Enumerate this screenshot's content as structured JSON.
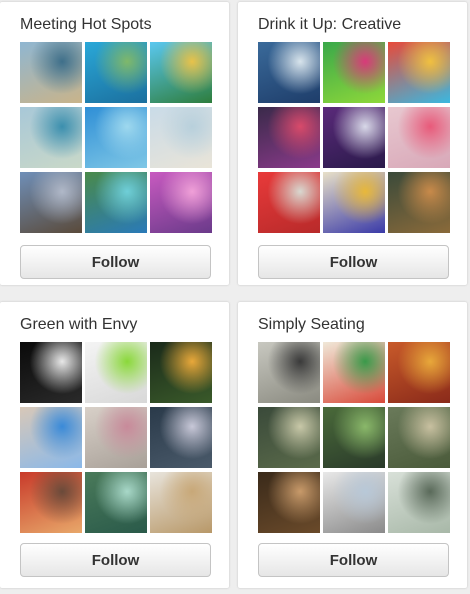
{
  "boards": [
    {
      "title": "Meeting Hot Spots",
      "follow_label": "Follow",
      "thumbnails": [
        {
          "colors": [
            "#8fb6d1",
            "#3e6f8a",
            "#c9b48a"
          ]
        },
        {
          "colors": [
            "#2aa8d8",
            "#7fb86a",
            "#1b6f9e"
          ]
        },
        {
          "colors": [
            "#5ac8f0",
            "#e8c24a",
            "#2e7d3c"
          ]
        },
        {
          "colors": [
            "#a8c8d8",
            "#3b8fae",
            "#c9d8c8"
          ]
        },
        {
          "colors": [
            "#2f8fd6",
            "#9ed8ee",
            "#7fc7e6"
          ]
        },
        {
          "colors": [
            "#c9dbe8",
            "#b8d0dc",
            "#e9e4d8"
          ]
        },
        {
          "colors": [
            "#6f8fb8",
            "#b0b8c8",
            "#5a4a3a"
          ]
        },
        {
          "colors": [
            "#4a8a4a",
            "#6fcfd8",
            "#2a7ab8"
          ]
        },
        {
          "colors": [
            "#c85ac0",
            "#f0a0d8",
            "#6a3a8a"
          ]
        }
      ]
    },
    {
      "title": "Drink it Up: Creative",
      "follow_label": "Follow",
      "thumbnails": [
        {
          "colors": [
            "#3a6a9a",
            "#d8e4ec",
            "#1e3d6a"
          ]
        },
        {
          "colors": [
            "#3aa84a",
            "#d83a7a",
            "#8ed83a"
          ]
        },
        {
          "colors": [
            "#e84a3a",
            "#f0c040",
            "#3ab8e0"
          ]
        },
        {
          "colors": [
            "#3a2a4a",
            "#d84a6a",
            "#8a3a8a"
          ]
        },
        {
          "colors": [
            "#5a2a7a",
            "#d8d8e8",
            "#2a1a4a"
          ]
        },
        {
          "colors": [
            "#e8c8d0",
            "#e85a7a",
            "#d8a8b8"
          ]
        },
        {
          "colors": [
            "#e83a3a",
            "#d8d8d0",
            "#b82a2a"
          ]
        },
        {
          "colors": [
            "#e8e0c8",
            "#e8b83a",
            "#3a3aa8"
          ]
        },
        {
          "colors": [
            "#3a4a3a",
            "#c88a4a",
            "#8a6a3a"
          ]
        }
      ]
    },
    {
      "title": "Green with Envy",
      "follow_label": "Follow",
      "thumbnails": [
        {
          "colors": [
            "#0a0a0a",
            "#e8e8e8",
            "#2a2a2a"
          ]
        },
        {
          "colors": [
            "#f4f4f4",
            "#8ad83a",
            "#d8d8d8"
          ]
        },
        {
          "colors": [
            "#1a2a1a",
            "#e8a83a",
            "#3a5a2a"
          ]
        },
        {
          "colors": [
            "#d8c8b8",
            "#3a8ad8",
            "#8ab8e8"
          ]
        },
        {
          "colors": [
            "#d8d0c8",
            "#c88a9a",
            "#a8a098"
          ]
        },
        {
          "colors": [
            "#2a3a4a",
            "#c8c8d8",
            "#4a5a6a"
          ]
        },
        {
          "colors": [
            "#c83a2a",
            "#6a4a3a",
            "#e8a86a"
          ]
        },
        {
          "colors": [
            "#4a7a5a",
            "#a8d8c8",
            "#2a5a4a"
          ]
        },
        {
          "colors": [
            "#e8e4dc",
            "#c8a878",
            "#b89868"
          ]
        }
      ]
    },
    {
      "title": "Simply Seating",
      "follow_label": "Follow",
      "thumbnails": [
        {
          "colors": [
            "#c8c8c0",
            "#3a3a3a",
            "#8a8a80"
          ]
        },
        {
          "colors": [
            "#f0e8d8",
            "#3a9a4a",
            "#d84a3a"
          ]
        },
        {
          "colors": [
            "#c85a2a",
            "#e8a83a",
            "#8a2a1a"
          ]
        },
        {
          "colors": [
            "#3a4a3a",
            "#c8c8a8",
            "#5a6a4a"
          ]
        },
        {
          "colors": [
            "#4a6a3a",
            "#8ab86a",
            "#2a3a2a"
          ]
        },
        {
          "colors": [
            "#6a7a5a",
            "#c8c0a0",
            "#4a5a3a"
          ]
        },
        {
          "colors": [
            "#3a2a1a",
            "#c89a6a",
            "#6a4a2a"
          ]
        },
        {
          "colors": [
            "#e8e8e8",
            "#b8c8d8",
            "#8a8a8a"
          ]
        },
        {
          "colors": [
            "#d8e0d8",
            "#5a6a5a",
            "#a8b8a8"
          ]
        }
      ]
    }
  ]
}
